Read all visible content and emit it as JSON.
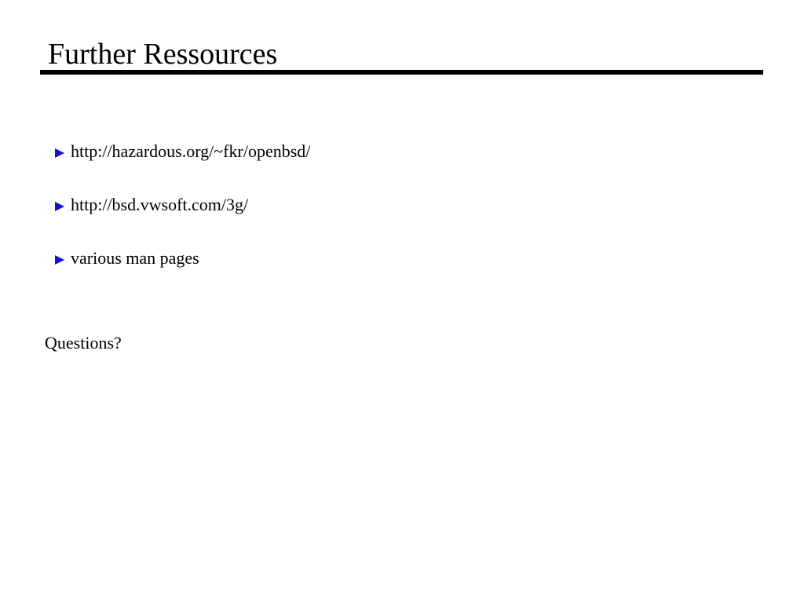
{
  "slide": {
    "title": "Further Ressources",
    "bullets": [
      {
        "text": "http://hazardous.org/~fkr/openbsd/"
      },
      {
        "text": "http://bsd.vwsoft.com/3g/"
      },
      {
        "text": "various man pages"
      }
    ],
    "closing": "Questions?"
  },
  "colors": {
    "text": "#000000",
    "bullet_marker": "#1010e0",
    "background": "#ffffff"
  },
  "icons": {
    "bullet": "triangle-right-icon"
  }
}
